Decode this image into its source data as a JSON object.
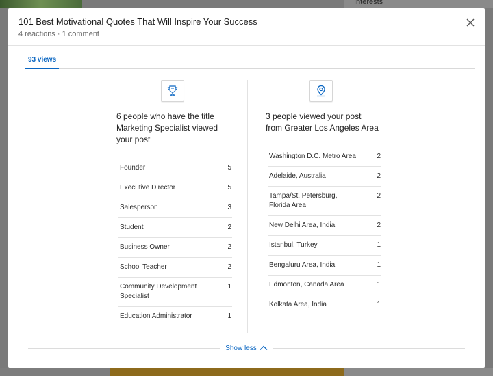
{
  "background": {
    "interests_label": "Interests"
  },
  "modal": {
    "title": "101 Best Motivational Quotes That Will Inspire Your Success",
    "subtitle": "4 reactions · 1 comment",
    "tab_label": "93 views",
    "show_less_label": "Show less"
  },
  "titles_panel": {
    "icon": "trophy-icon",
    "heading": "6 people who have the title Marketing Specialist viewed your post",
    "rows": [
      {
        "label": "Founder",
        "count": "5"
      },
      {
        "label": "Executive Director",
        "count": "5"
      },
      {
        "label": "Salesperson",
        "count": "3"
      },
      {
        "label": "Student",
        "count": "2"
      },
      {
        "label": "Business Owner",
        "count": "2"
      },
      {
        "label": "School Teacher",
        "count": "2"
      },
      {
        "label": "Community Development Specialist",
        "count": "1"
      },
      {
        "label": "Education Administrator",
        "count": "1"
      }
    ]
  },
  "locations_panel": {
    "icon": "location-pin-icon",
    "heading": "3 people viewed your post from Greater Los Angeles Area",
    "rows": [
      {
        "label": "Washington D.C. Metro Area",
        "count": "2"
      },
      {
        "label": "Adelaide, Australia",
        "count": "2"
      },
      {
        "label": "Tampa/St. Petersburg, Florida Area",
        "count": "2"
      },
      {
        "label": "New Delhi Area, India",
        "count": "2"
      },
      {
        "label": "Istanbul, Turkey",
        "count": "1"
      },
      {
        "label": "Bengaluru Area, India",
        "count": "1"
      },
      {
        "label": "Edmonton, Canada Area",
        "count": "1"
      },
      {
        "label": "Kolkata Area, India",
        "count": "1"
      }
    ]
  },
  "colors": {
    "accent": "#0a66c2"
  }
}
